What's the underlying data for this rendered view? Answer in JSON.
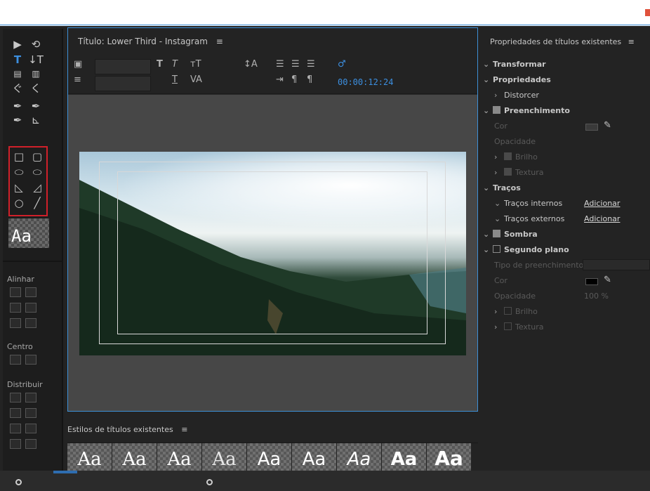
{
  "panel_title": "Título: Lower Third - Instagram",
  "menu_glyph": "≡",
  "timecode": "00:00:12:24",
  "tools": {
    "align_label": "Alinhar",
    "center_label": "Centro",
    "distribute_label": "Distribuir",
    "preview_text": "Aa"
  },
  "styles_panel": {
    "title": "Estilos de títulos existentes",
    "swatches": [
      "Aa",
      "Aa",
      "Aa",
      "Aa",
      "Aa",
      "Aa",
      "Aa",
      "Aa",
      "Aa"
    ]
  },
  "properties": {
    "title": "Propriedades de títulos existentes",
    "rows": {
      "transformar": "Transformar",
      "propriedades": "Propriedades",
      "distorcer": "Distorcer",
      "preenchimento": "Preenchimento",
      "cor": "Cor",
      "opacidade": "Opacidade",
      "brilho": "Brilho",
      "textura": "Textura",
      "tracos": "Traços",
      "tracos_internos": "Traços internos",
      "tracos_externos": "Traços externos",
      "adicionar": "Adicionar",
      "sombra": "Sombra",
      "segundo_plano": "Segundo plano",
      "tipo_preenchimento": "Tipo de preenchimento",
      "opacidade_valor": "100 %"
    }
  },
  "colors": {
    "accent_blue": "#3c8fe0",
    "selection_red": "#d0202a"
  }
}
